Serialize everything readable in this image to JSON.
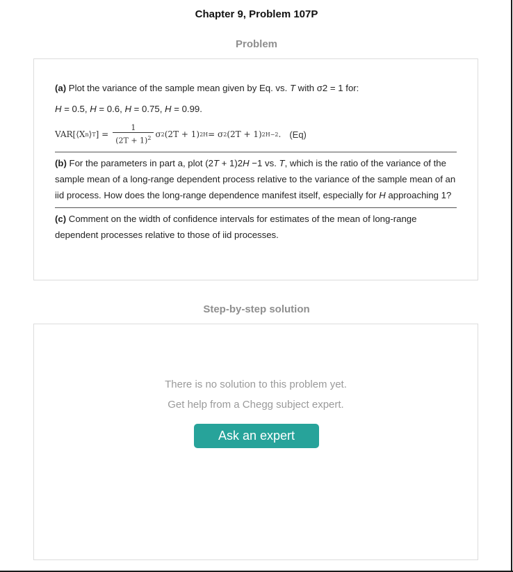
{
  "page": {
    "title": "Chapter 9, Problem 107P",
    "problem_heading": "Problem",
    "solution_heading": "Step-by-step solution"
  },
  "problem": {
    "part_a": {
      "label": "(a)",
      "text_pre": " Plot the variance of the sample mean given by Eq. vs. ",
      "var": "T",
      "text_post": " with σ2 = 1 for:"
    },
    "h_values": {
      "h": "H",
      "v1": " = 0.5, ",
      "v2": " = 0.6, ",
      "v3": " = 0.75, ",
      "v4": " = 0.99."
    },
    "equation": {
      "lhs": "VAR[⟨X",
      "lhs_sub_n": "n",
      "lhs_close": "⟩",
      "lhs_sub_T": "T",
      "lhs_end": "] =",
      "frac_num": "1",
      "frac_den": "(2T + 1)",
      "frac_den_exp": "2",
      "mid": "σ",
      "mid_exp": "2",
      "mid_term": "(2T + 1)",
      "mid_term_exp": "2H",
      "eq2": " = σ",
      "eq2_exp": "2",
      "rhs_term": "(2T + 1)",
      "rhs_term_exp": "2H−2",
      "rhs_end": ".",
      "tag": "(Eq)"
    },
    "part_b": {
      "label": "(b)",
      "t1": " For the parameters in part a, plot (2",
      "v1": "T",
      "t2": " + 1)2",
      "v2": "H",
      "t3": " −1 vs. ",
      "v3": "T",
      "t4": ", which is the ratio of the variance of the sample mean of a long-range dependent process relative to the variance of the sample mean of an iid process. How does the long-range dependence manifest itself, especially for ",
      "v4": "H",
      "t5": " approaching 1?"
    },
    "part_c": {
      "label": "(c)",
      "text": " Comment on the width of confidence intervals for estimates of the mean of long-range dependent processes relative to those of iid processes."
    }
  },
  "solution": {
    "message_line1": "There is no solution to this problem yet.",
    "message_line2": "Get help from a Chegg subject expert.",
    "ask_button_label": "Ask an expert",
    "button_color": "#27a39a"
  }
}
